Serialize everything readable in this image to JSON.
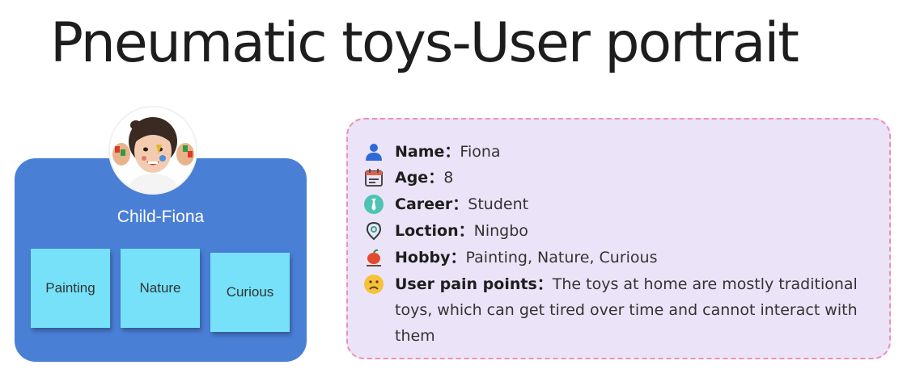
{
  "title": "Pneumatic toys-User portrait",
  "card": {
    "name": "Child-Fiona",
    "tags": [
      "Painting",
      "Nature",
      "Curious"
    ]
  },
  "info": {
    "name_label": "Name：",
    "name_value": "Fiona",
    "age_label": "Age：",
    "age_value": "8",
    "career_label": "Career：",
    "career_value": "Student",
    "location_label": "Loction：",
    "location_value": "Ningbo",
    "hobby_label": "Hobby：",
    "hobby_value": "Painting, Nature, Curious",
    "pain_label": "User pain points：",
    "pain_value": "The toys at home are mostly traditional toys, which can get tired over time and cannot interact with them"
  },
  "icons": {
    "name": "person-icon",
    "age": "calendar-icon",
    "career": "tie-icon",
    "location": "location-pin-icon",
    "hobby": "apple-icon",
    "pain": "sad-face-icon"
  },
  "colors": {
    "card": "#4a7fd6",
    "sticky": "#76e1f9",
    "info_bg": "#ebe4f8",
    "info_border": "#f08fb1"
  }
}
